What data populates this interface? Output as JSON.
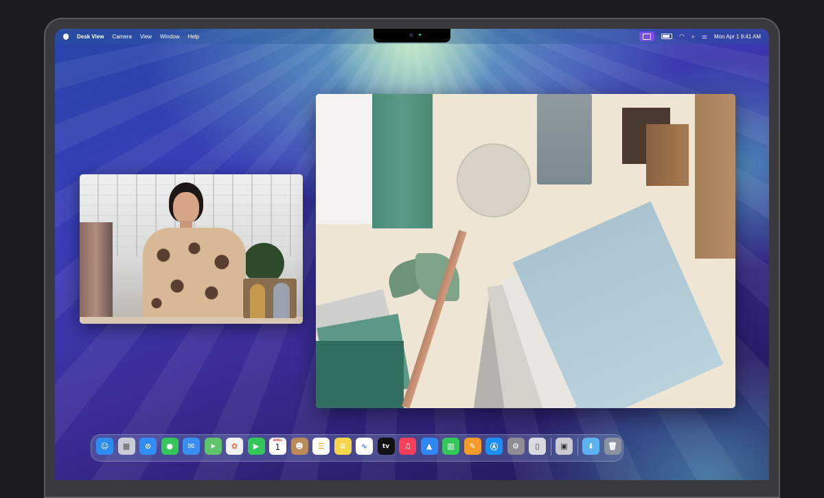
{
  "menubar": {
    "app_name": "Desk View",
    "menus": [
      "Camera",
      "View",
      "Window",
      "Help"
    ],
    "clock": "Mon Apr 1  9:41 AM",
    "status_icons": [
      "desk-view-status-icon",
      "battery-icon",
      "wifi-icon",
      "spotlight-search-icon",
      "control-center-icon"
    ]
  },
  "dock": {
    "apps": [
      {
        "name": "Finder",
        "icon": "finder-icon",
        "color": "#2d8cf0"
      },
      {
        "name": "Launchpad",
        "icon": "launchpad-icon",
        "color": "#c8ccd6"
      },
      {
        "name": "Safari",
        "icon": "safari-icon",
        "color": "#2f8ef5"
      },
      {
        "name": "Messages",
        "icon": "messages-icon",
        "color": "#35c759"
      },
      {
        "name": "Mail",
        "icon": "mail-icon",
        "color": "#3a8df3"
      },
      {
        "name": "Maps",
        "icon": "maps-icon",
        "color": "#5fc36b"
      },
      {
        "name": "Photos",
        "icon": "photos-icon",
        "color": "#f2f2f2"
      },
      {
        "name": "FaceTime",
        "icon": "facetime-icon",
        "color": "#33c759"
      },
      {
        "name": "Calendar",
        "icon": "calendar-icon",
        "color": "#ffffff"
      },
      {
        "name": "Contacts",
        "icon": "contacts-icon",
        "color": "#b98a5a"
      },
      {
        "name": "Reminders",
        "icon": "reminders-icon",
        "color": "#ffffff"
      },
      {
        "name": "Notes",
        "icon": "notes-icon",
        "color": "#f7d54a"
      },
      {
        "name": "Freeform",
        "icon": "freeform-icon",
        "color": "#ffffff"
      },
      {
        "name": "TV",
        "icon": "tv-icon",
        "color": "#111111"
      },
      {
        "name": "Music",
        "icon": "music-icon",
        "color": "#fa3f5a"
      },
      {
        "name": "Keynote",
        "icon": "keynote-icon",
        "color": "#2f86f6"
      },
      {
        "name": "Numbers",
        "icon": "numbers-icon",
        "color": "#34c759"
      },
      {
        "name": "Pages",
        "icon": "pages-icon",
        "color": "#f59b2a"
      },
      {
        "name": "App Store",
        "icon": "app-store-icon",
        "color": "#1d8ef5"
      },
      {
        "name": "System Settings",
        "icon": "system-settings-icon",
        "color": "#8e8e93"
      },
      {
        "name": "iPhone Mirroring",
        "icon": "iphone-mirroring-icon",
        "color": "#d9dbe0"
      },
      {
        "name": "Desk View",
        "icon": "desk-view-icon",
        "color": "#c9ccd2"
      },
      {
        "name": "Downloads",
        "icon": "downloads-folder-icon",
        "color": "#5fb2f0"
      },
      {
        "name": "Trash",
        "icon": "trash-icon",
        "color": "#8b93a1"
      }
    ],
    "calendar": {
      "month": "APRIL",
      "day": "1"
    },
    "tv_label": "tv"
  }
}
